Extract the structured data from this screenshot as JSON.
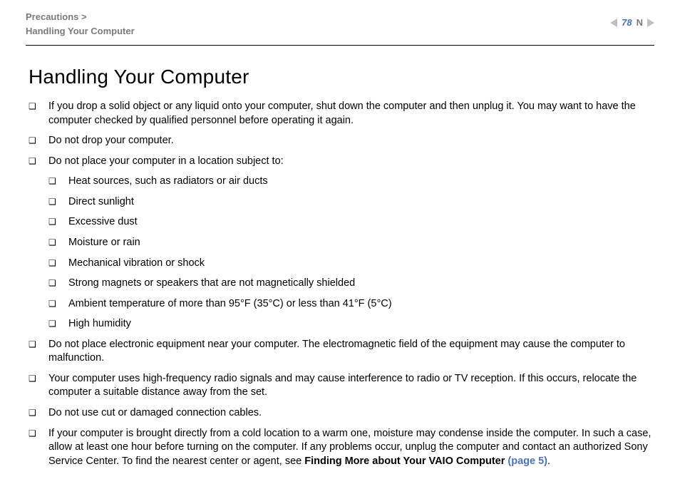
{
  "header": {
    "breadcrumb_section": "Precautions >",
    "breadcrumb_page": "Handling Your Computer",
    "page_number": "78",
    "nav_n": "N"
  },
  "content": {
    "title": "Handling Your Computer",
    "items": [
      "If you drop a solid object or any liquid onto your computer, shut down the computer and then unplug it. You may want to have the computer checked by qualified personnel before operating it again.",
      "Do not drop your computer.",
      "Do not place your computer in a location subject to:"
    ],
    "sub_items": [
      "Heat sources, such as radiators or air ducts",
      "Direct sunlight",
      "Excessive dust",
      "Moisture or rain",
      "Mechanical vibration or shock",
      "Strong magnets or speakers that are not magnetically shielded",
      "Ambient temperature of more than 95°F (35°C) or less than 41°F (5°C)",
      "High humidity"
    ],
    "items2": [
      "Do not place electronic equipment near your computer. The electromagnetic field of the equipment may cause the computer to malfunction.",
      "Your computer uses high-frequency radio signals and may cause interference to radio or TV reception. If this occurs, relocate the computer a suitable distance away from the set.",
      "Do not use cut or damaged connection cables."
    ],
    "final_item": {
      "prefix": "If your computer is brought directly from a cold location to a warm one, moisture may condense inside the computer. In such a case, allow at least one hour before turning on the computer. If any problems occur, unplug the computer and contact an authorized Sony Service Center. To find the nearest center or agent, see ",
      "bold": "Finding More about Your VAIO Computer ",
      "link": "(page 5)",
      "suffix": "."
    }
  }
}
